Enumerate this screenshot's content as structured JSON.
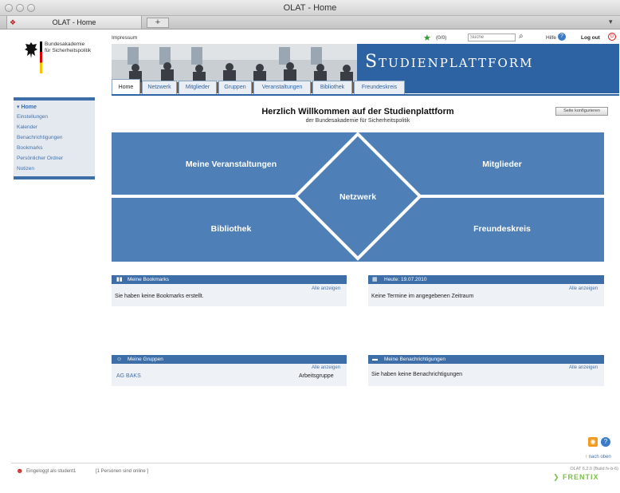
{
  "window": {
    "title": "OLAT - Home",
    "tab_title": "OLAT - Home",
    "new_tab": "+"
  },
  "sidebar": {
    "org_name": "Bundesakademie\nfür Sicherheitspolitik",
    "items": [
      {
        "label": "▾ Home"
      },
      {
        "label": "Einstellungen"
      },
      {
        "label": "Kalender"
      },
      {
        "label": "Benachrichtigungen"
      },
      {
        "label": "Bookmarks"
      },
      {
        "label": "Persönlicher Ordner"
      },
      {
        "label": "Notizen"
      }
    ]
  },
  "topbar": {
    "impressum": "Impressum",
    "session_count": "(0/0)",
    "search_placeholder": "Suche",
    "help": "Hilfe",
    "logout": "Log out"
  },
  "banner": {
    "title": "Studienplattform"
  },
  "tabs": [
    {
      "label": "Home"
    },
    {
      "label": "Netzwerk"
    },
    {
      "label": "Mitglieder"
    },
    {
      "label": "Gruppen"
    },
    {
      "label": "Veranstaltungen"
    },
    {
      "label": "Bibliothek"
    },
    {
      "label": "Freundeskreis"
    }
  ],
  "main": {
    "title": "Herzlich Willkommen auf der Studienplattform",
    "subtitle": "der Bundesakademie für Sicherheitspolitik",
    "configure_button": "Seite konfigurieren",
    "tiles": {
      "top_left": "Meine Veranstaltungen",
      "top_right": "Mitglieder",
      "center": "Netzwerk",
      "bottom_left": "Bibliothek",
      "bottom_right": "Freundeskreis"
    }
  },
  "portlets": {
    "bookmarks": {
      "title": "Meine Bookmarks",
      "all_link": "Alle anzeigen",
      "text": "Sie haben keine Bookmarks erstellt."
    },
    "today": {
      "title": "Heute: 19.07.2010",
      "all_link": "Alle anzeigen",
      "text": "Keine Termine im angegebenen Zeitraum"
    },
    "groups": {
      "title": "Meine Gruppen",
      "all_link": "Alle anzeigen",
      "group_name": "AG BAKS",
      "group_type": "Arbeitsgruppe"
    },
    "notifications": {
      "title": "Meine Benachrichtigungen",
      "all_link": "Alle anzeigen",
      "text": "Sie haben keine Benachrichtigungen"
    }
  },
  "footer": {
    "back_to_top": "↑ nach oben",
    "logged_in": "Eingeloggt als student1",
    "online": "[1 Personen sind online ]",
    "version": "OLAT 6.2.0 (Build fv-b-6)",
    "brand": "FRENTIX"
  },
  "colors": {
    "brand_blue": "#2d63a3",
    "tile_blue": "#4f7fb7",
    "link_blue": "#4471a8"
  }
}
